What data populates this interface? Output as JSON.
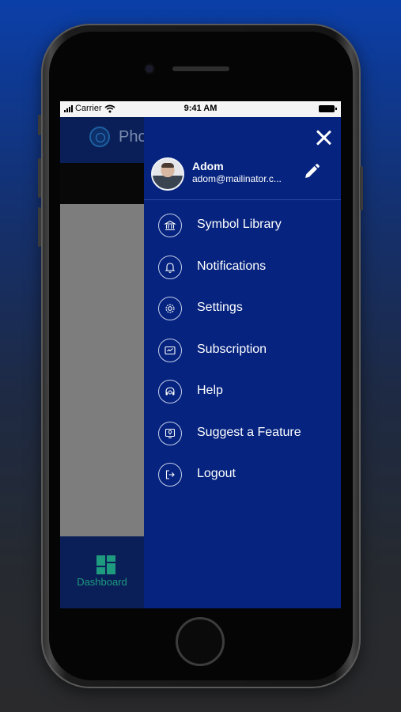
{
  "status_bar": {
    "carrier": "Carrier",
    "time": "9:41 AM"
  },
  "app": {
    "title": "Pho",
    "tab": {
      "label": "Dashboard"
    }
  },
  "drawer": {
    "user": {
      "name": "Adom",
      "email": "adom@mailinator.c..."
    },
    "menu": [
      {
        "label": "Symbol Library",
        "icon": "library-icon"
      },
      {
        "label": "Notifications",
        "icon": "bell-icon"
      },
      {
        "label": "Settings",
        "icon": "gear-icon"
      },
      {
        "label": "Subscription",
        "icon": "subscription-icon"
      },
      {
        "label": "Help",
        "icon": "headset-icon"
      },
      {
        "label": "Suggest a Feature",
        "icon": "lightbulb-icon"
      },
      {
        "label": "Logout",
        "icon": "logout-icon"
      }
    ]
  },
  "colors": {
    "drawer_bg": "#05237f",
    "header_bg": "#0a1f58",
    "accent_green": "#1e9a7e"
  }
}
